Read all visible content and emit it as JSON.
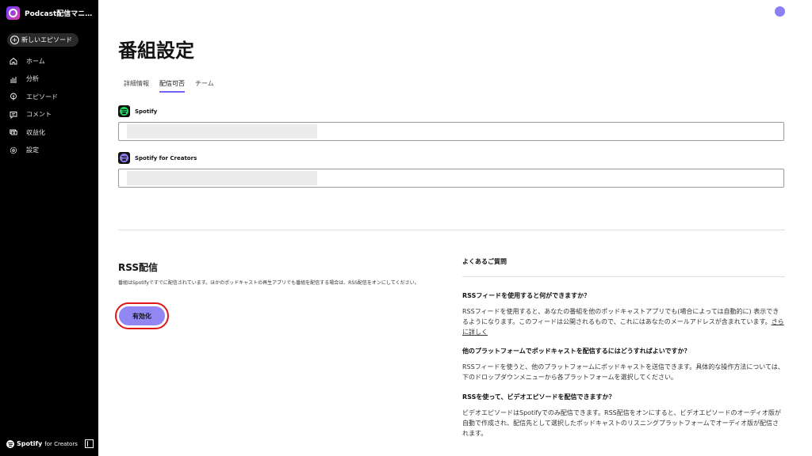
{
  "sidebar": {
    "brand_title": "Podcast配信マニュ...",
    "new_episode": "新しいエピソード",
    "items": [
      {
        "label": "ホーム",
        "icon": "home-icon"
      },
      {
        "label": "分析",
        "icon": "bar-chart-icon"
      },
      {
        "label": "エピソード",
        "icon": "podcast-icon"
      },
      {
        "label": "コメント",
        "icon": "comment-icon"
      },
      {
        "label": "収益化",
        "icon": "money-icon"
      },
      {
        "label": "設定",
        "icon": "gear-icon"
      }
    ],
    "footer_brand": "Spotify",
    "footer_sub": "for Creators"
  },
  "page": {
    "title": "番組設定"
  },
  "tabs": [
    "詳細情報",
    "配信可否",
    "チーム"
  ],
  "active_tab": "配信可否",
  "platforms": [
    {
      "name": "Spotify",
      "url": ""
    },
    {
      "name": "Spotify for Creators",
      "url": ""
    }
  ],
  "rss": {
    "title": "RSS配信",
    "description": "番組はSpotifyですでに配信されています。ほかのポッドキャストの再生アプリでも番組を配信する場合は、RSS配信をオンにしてください。",
    "button": "有効化"
  },
  "faq": {
    "heading": "よくあるご質問",
    "items": [
      {
        "q": "RSSフィードを使用すると何ができますか？",
        "a": "RSSフィードを使用すると、あなたの番組を他のポッドキャストアプリでも(場合によっては自動的に) 表示できるようになります。このフィードは公開されるもので、これにはあなたのメールアドレスが含まれています。",
        "link": "さらに詳しく"
      },
      {
        "q": "他のプラットフォームでポッドキャストを配信するにはどうすればよいですか？",
        "a": "RSSフィードを使うと、他のプラットフォームにポッドキャストを送信できます。具体的な操作方法については、下のドロップダウンメニューから各プラットフォームを選択してください。"
      },
      {
        "q": "RSSを使って、ビデオエピソードを配信できますか？",
        "a": "ビデオエピソードはSpotifyでのみ配信できます。RSS配信をオンにすると、ビデオエピソードのオーディオ版が自動で作成され、配信先として選択したポッドキャストのリスニングプラットフォームでオーディオ版が配信されます。"
      }
    ]
  },
  "colors": {
    "accent": "#9187f2",
    "highlight": "#e01616",
    "spotify_green": "#1ed760",
    "creators_purple": "#8c7ef4"
  }
}
